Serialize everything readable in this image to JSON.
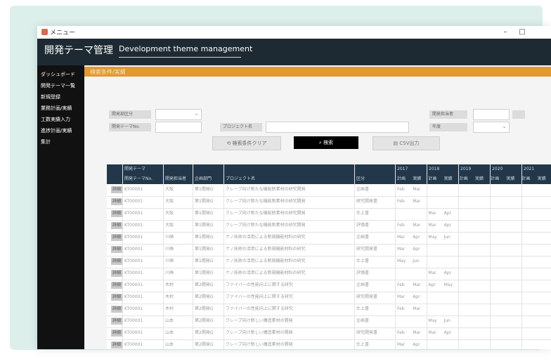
{
  "window": {
    "title": "メニュー",
    "min": "–",
    "max": "□"
  },
  "header": {
    "title_jp": "開発テーマ管理",
    "title_en": "Development theme management"
  },
  "sidebar": {
    "items": [
      "ダッシュボード",
      "開発テーマ一覧",
      "新規登録",
      "業務計画/実績",
      "工数実績入力",
      "進捗計画/実績",
      "集計"
    ]
  },
  "section": {
    "title": "検索条件/実績"
  },
  "filters": {
    "row1": {
      "label_a": "開発部区分",
      "label_b": "開発担当者"
    },
    "row2": {
      "label_a": "開発テーマNo.",
      "label_b": "プロジェクト名",
      "label_c": "年度"
    }
  },
  "actions": {
    "clear": "検索条件クリア",
    "search": "検索",
    "export": "CSV出力"
  },
  "table": {
    "header_top": "開発テーマ",
    "years": [
      "2017",
      "2018",
      "2019",
      "2020",
      "2021"
    ],
    "columns": [
      "開発テーマNo.",
      "開発担当者",
      "企画部門",
      "プロジェクト名",
      "区分"
    ],
    "month_labels": [
      "計画",
      "実績"
    ],
    "rows": [
      {
        "btn": "詳細",
        "no": "KT00001",
        "owner": "大阪",
        "dept": "第1開発G",
        "name": "クレープ向け新たな機能新素材の研究開発",
        "type": "企画書",
        "m": [
          "Feb",
          "Mar",
          "",
          "",
          "",
          "",
          "",
          "",
          "",
          "",
          "",
          "",
          "",
          ""
        ]
      },
      {
        "btn": "詳細",
        "no": "KT00001",
        "owner": "大阪",
        "dept": "第1開発G",
        "name": "クレープ向け新たな機能新素材の研究開発",
        "type": "研究開発書",
        "m": [
          "Feb",
          "Mar",
          "",
          "",
          "",
          "",
          "",
          "",
          "",
          "",
          "",
          "",
          "",
          ""
        ]
      },
      {
        "btn": "詳細",
        "no": "KT00001",
        "owner": "大阪",
        "dept": "第1開発G",
        "name": "クレープ向け新たな機能新素材の研究開発",
        "type": "仕上書",
        "m": [
          "",
          "",
          "Mar",
          "Apr",
          "",
          "",
          "",
          "",
          "",
          "",
          "",
          "",
          "",
          ""
        ]
      },
      {
        "btn": "詳細",
        "no": "KT00001",
        "owner": "大阪",
        "dept": "第1開発G",
        "name": "クレープ向け新たな機能新素材の研究開発",
        "type": "評価書",
        "m": [
          "Feb",
          "Mar",
          "Mar",
          "Apr",
          "",
          "",
          "",
          "",
          "",
          "",
          "",
          "",
          "",
          ""
        ]
      },
      {
        "btn": "詳細",
        "no": "KT00001",
        "owner": "川崎",
        "dept": "第1開発G",
        "name": "ナノ技術の活用による新規機能材料の研究",
        "type": "企画書",
        "m": [
          "Mar",
          "Apr",
          "May",
          "Jun",
          "",
          "",
          "",
          "",
          "",
          "",
          "",
          "",
          "",
          ""
        ]
      },
      {
        "btn": "詳細",
        "no": "KT00001",
        "owner": "川崎",
        "dept": "第1開発G",
        "name": "ナノ技術の活用による新規機能材料の研究",
        "type": "研究開発書",
        "m": [
          "Mar",
          "Apr",
          "",
          "",
          "",
          "",
          "",
          "",
          "",
          "",
          "",
          "",
          "",
          ""
        ]
      },
      {
        "btn": "詳細",
        "no": "KT00001",
        "owner": "川崎",
        "dept": "第1開発G",
        "name": "ナノ技術の活用による新規機能材料の研究",
        "type": "仕上書",
        "m": [
          "May",
          "Jun",
          "",
          "",
          "",
          "",
          "",
          "",
          "",
          "",
          "",
          "",
          "",
          ""
        ]
      },
      {
        "btn": "詳細",
        "no": "KT00001",
        "owner": "川崎",
        "dept": "第1開発G",
        "name": "ナノ技術の活用による新規機能材料の研究",
        "type": "評価書",
        "m": [
          "",
          "",
          "Mar",
          "Apr",
          "",
          "",
          "",
          "",
          "",
          "",
          "",
          "",
          "",
          ""
        ]
      },
      {
        "btn": "詳細",
        "no": "KT00001",
        "owner": "木村",
        "dept": "第2開発G",
        "name": "ファイバーの性能向上に関する研究",
        "type": "企画書",
        "m": [
          "Feb",
          "Mar",
          "Apr",
          "May",
          "",
          "",
          "",
          "",
          "",
          "",
          "",
          "",
          "",
          ""
        ]
      },
      {
        "btn": "詳細",
        "no": "KT00001",
        "owner": "木村",
        "dept": "第2開発G",
        "name": "ファイバーの性能向上に関する研究",
        "type": "研究開発書",
        "m": [
          "Mar",
          "Apr",
          "",
          "",
          "",
          "",
          "",
          "",
          "",
          "",
          "",
          "",
          "",
          ""
        ]
      },
      {
        "btn": "詳細",
        "no": "KT00001",
        "owner": "木村",
        "dept": "第2開発G",
        "name": "ファイバーの性能向上に関する研究",
        "type": "仕上書",
        "m": [
          "Feb",
          "Mar",
          "",
          "",
          "",
          "",
          "",
          "",
          "",
          "",
          "",
          "",
          "",
          ""
        ]
      },
      {
        "btn": "詳細",
        "no": "KT00001",
        "owner": "山本",
        "dept": "第2開発G",
        "name": "クレープ向け新しい構造素材の開発",
        "type": "企画書",
        "m": [
          "",
          "",
          "May",
          "Jun",
          "",
          "",
          "",
          "",
          "",
          "",
          "",
          "",
          "",
          ""
        ]
      },
      {
        "btn": "詳細",
        "no": "KT00001",
        "owner": "山本",
        "dept": "第2開発G",
        "name": "クレープ向け新しい構造素材の開発",
        "type": "研究開発書",
        "m": [
          "Feb",
          "Mar",
          "Mar",
          "Apr",
          "",
          "",
          "",
          "",
          "",
          "",
          "",
          "",
          "",
          ""
        ]
      },
      {
        "btn": "詳細",
        "no": "KT00001",
        "owner": "山本",
        "dept": "第2開発G",
        "name": "クレープ向け新しい構造素材の開発",
        "type": "仕上書",
        "m": [
          "Mar",
          "Apr",
          "",
          "",
          "",
          "",
          "",
          "",
          "",
          "",
          "",
          "",
          "",
          ""
        ]
      }
    ]
  },
  "colors": {
    "accent": "#e3992e",
    "header": "#1e2a33",
    "table_header": "#22374a",
    "sidebar": "#111111",
    "teal_bg": "#dcefeb"
  }
}
